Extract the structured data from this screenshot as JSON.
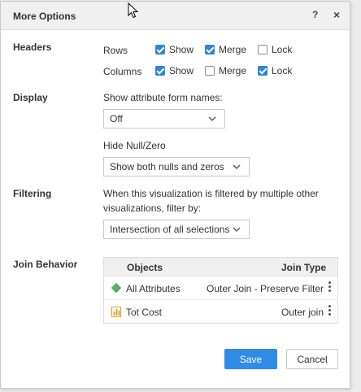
{
  "dialog": {
    "title": "More Options",
    "help": "?",
    "close": "×"
  },
  "headers": {
    "label": "Headers",
    "rows": {
      "label": "Rows",
      "show": {
        "label": "Show",
        "checked": true
      },
      "merge": {
        "label": "Merge",
        "checked": true
      },
      "lock": {
        "label": "Lock",
        "checked": false
      }
    },
    "columns": {
      "label": "Columns",
      "show": {
        "label": "Show",
        "checked": true
      },
      "merge": {
        "label": "Merge",
        "checked": false
      },
      "lock": {
        "label": "Lock",
        "checked": true
      }
    }
  },
  "display": {
    "label": "Display",
    "attr_form_label": "Show attribute form names:",
    "attr_form_value": "Off",
    "hide_null_label": "Hide Null/Zero",
    "hide_null_value": "Show both nulls and zeros"
  },
  "filtering": {
    "label": "Filtering",
    "desc_line1": "When this visualization is filtered by multiple other",
    "desc_line2": "visualizations, filter by:",
    "value": "Intersection of all selections"
  },
  "join": {
    "label": "Join Behavior",
    "col_objects": "Objects",
    "col_join_type": "Join Type",
    "rows": [
      {
        "name": "All Attributes",
        "join_type": "Outer Join - Preserve Filter",
        "icon": "attribute-diamond-icon",
        "color": "#55b36a"
      },
      {
        "name": "Tot Cost",
        "join_type": "Outer join",
        "icon": "metric-icon",
        "color": "#e0a030"
      }
    ]
  },
  "buttons": {
    "save": "Save",
    "cancel": "Cancel"
  },
  "colors": {
    "accent": "#2f8be6",
    "checkbox": "#2f84d8"
  }
}
